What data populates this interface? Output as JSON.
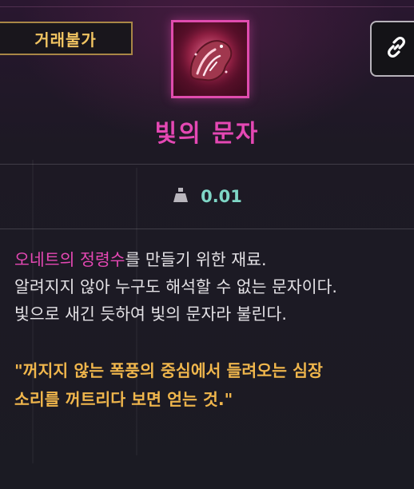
{
  "trade_status": "거래불가",
  "item": {
    "name": "빛의 문자",
    "icon": "glowing-letter-scroll-icon",
    "rarity_color": "#e548b4"
  },
  "link_button": {
    "icon": "link-icon"
  },
  "weight": {
    "icon": "weight-icon",
    "value": "0.01"
  },
  "description": {
    "line1_highlight": "오네트의 정령수",
    "line1_rest": "를 만들기 위한 재료.",
    "line2": "알려지지 않아 누구도 해석할 수 없는 문자이다.",
    "line3": "빛으로 새긴 듯하여 빛의 문자라 불린다."
  },
  "quote": {
    "line1": "\"꺼지지 않는 폭풍의 중심에서 들려오는 심장",
    "line2": "소리를 꺼트리다 보면 얻는 것.\""
  },
  "colors": {
    "badge_text": "#f1c462",
    "badge_border": "#a98746",
    "weight_value": "#7fd6c6",
    "quote_text": "#f0b64c",
    "highlight": "#e548b4"
  }
}
